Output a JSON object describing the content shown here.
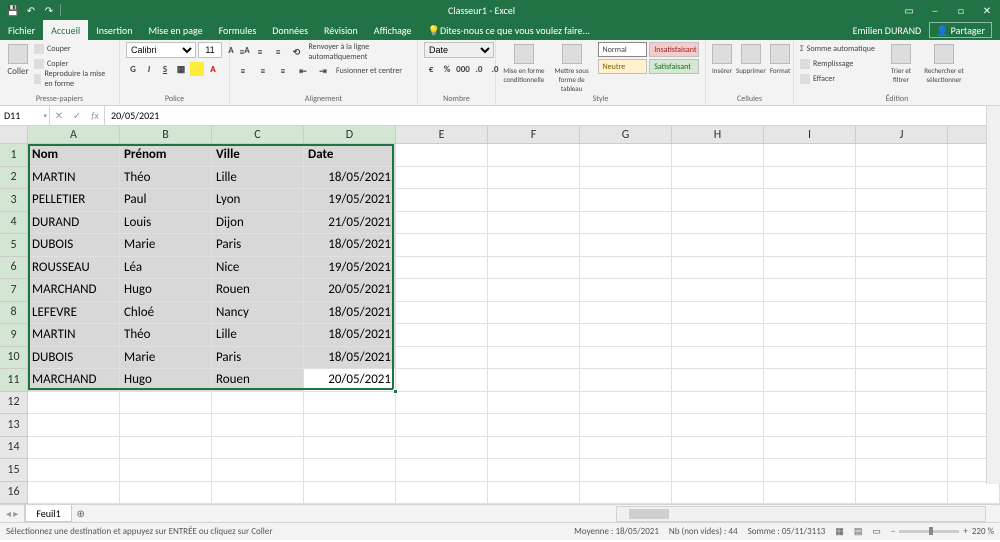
{
  "title": "Classeur1 - Excel",
  "user": "Emilien DURAND",
  "share": "Partager",
  "tellme": "Dites-nous ce que vous voulez faire...",
  "tabs": {
    "file": "Fichier",
    "home": "Accueil",
    "insert": "Insertion",
    "layout": "Mise en page",
    "formulas": "Formules",
    "data": "Données",
    "review": "Révision",
    "view": "Affichage"
  },
  "ribbon": {
    "paste": "Coller",
    "cut": "Couper",
    "copy": "Copier",
    "fmtpainter": "Reproduire la mise en forme",
    "clipboard": "Presse-papiers",
    "font_name": "Calibri",
    "font_size": "11",
    "font": "Police",
    "wrap": "Renvoyer à la ligne automatiquement",
    "merge": "Fusionner et centrer",
    "alignment": "Alignement",
    "numfmt": "Date",
    "number": "Nombre",
    "condfmt": "Mise en forme conditionnelle",
    "tablefmt": "Mettre sous forme de tableau",
    "style_normal": "Normal",
    "style_bad": "Insatisfaisant",
    "style_neutral": "Neutre",
    "style_good": "Satisfaisant",
    "style": "Style",
    "insert_c": "Insérer",
    "delete_c": "Supprimer",
    "format_c": "Format",
    "cells": "Cellules",
    "autosum": "Somme automatique",
    "fill": "Remplissage",
    "clear": "Effacer",
    "sort": "Trier et filtrer",
    "find": "Rechercher et sélectionner",
    "editing": "Édition"
  },
  "fbar": {
    "name": "D11",
    "formula": "20/05/2021"
  },
  "columns": [
    "A",
    "B",
    "C",
    "D",
    "E",
    "F",
    "G",
    "H",
    "I",
    "J"
  ],
  "headers": [
    "Nom",
    "Prénom",
    "Ville",
    "Date"
  ],
  "rows": [
    {
      "n": "MARTIN",
      "p": "Théo",
      "v": "Lille",
      "d": "18/05/2021"
    },
    {
      "n": "PELLETIER",
      "p": "Paul",
      "v": "Lyon",
      "d": "19/05/2021"
    },
    {
      "n": "DURAND",
      "p": "Louis",
      "v": "Dijon",
      "d": "21/05/2021"
    },
    {
      "n": "DUBOIS",
      "p": "Marie",
      "v": "Paris",
      "d": "18/05/2021"
    },
    {
      "n": "ROUSSEAU",
      "p": "Léa",
      "v": "Nice",
      "d": "19/05/2021"
    },
    {
      "n": "MARCHAND",
      "p": "Hugo",
      "v": "Rouen",
      "d": "20/05/2021"
    },
    {
      "n": "LEFEVRE",
      "p": "Chloé",
      "v": "Nancy",
      "d": "18/05/2021"
    },
    {
      "n": "MARTIN",
      "p": "Théo",
      "v": "Lille",
      "d": "18/05/2021"
    },
    {
      "n": "DUBOIS",
      "p": "Marie",
      "v": "Paris",
      "d": "18/05/2021"
    },
    {
      "n": "MARCHAND",
      "p": "Hugo",
      "v": "Rouen",
      "d": "20/05/2021"
    }
  ],
  "sheet": "Feuil1",
  "status": {
    "msg": "Sélectionnez une destination et appuyez sur ENTRÉE ou cliquez sur Coller",
    "avg_lbl": "Moyenne :",
    "avg": "18/05/2021",
    "cnt_lbl": "Nb (non vides) :",
    "cnt": "44",
    "sum_lbl": "Somme :",
    "sum": "05/11/3113",
    "zoom": "220 %"
  },
  "chart_data": {
    "type": "table",
    "headers": [
      "Nom",
      "Prénom",
      "Ville",
      "Date"
    ],
    "rows": [
      [
        "MARTIN",
        "Théo",
        "Lille",
        "18/05/2021"
      ],
      [
        "PELLETIER",
        "Paul",
        "Lyon",
        "19/05/2021"
      ],
      [
        "DURAND",
        "Louis",
        "Dijon",
        "21/05/2021"
      ],
      [
        "DUBOIS",
        "Marie",
        "Paris",
        "18/05/2021"
      ],
      [
        "ROUSSEAU",
        "Léa",
        "Nice",
        "19/05/2021"
      ],
      [
        "MARCHAND",
        "Hugo",
        "Rouen",
        "20/05/2021"
      ],
      [
        "LEFEVRE",
        "Chloé",
        "Nancy",
        "18/05/2021"
      ],
      [
        "MARTIN",
        "Théo",
        "Lille",
        "18/05/2021"
      ],
      [
        "DUBOIS",
        "Marie",
        "Paris",
        "18/05/2021"
      ],
      [
        "MARCHAND",
        "Hugo",
        "Rouen",
        "20/05/2021"
      ]
    ]
  }
}
